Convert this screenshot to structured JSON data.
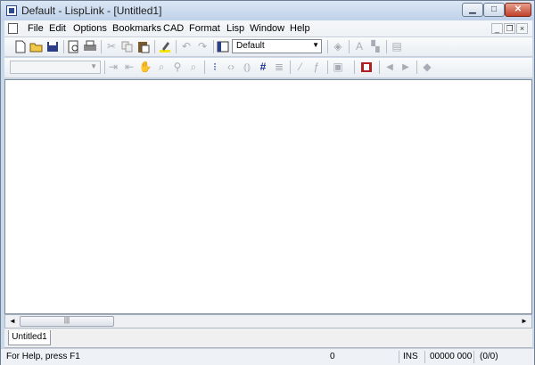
{
  "window": {
    "title": "Default - LispLink - [Untitled1]",
    "caption_buttons": {
      "minimize": "▁",
      "maximize": "□",
      "close": "✕"
    }
  },
  "menubar": {
    "items": [
      "File",
      "Edit",
      "Options",
      "Bookmarks",
      "CAD",
      "Format",
      "Lisp",
      "Window",
      "Help"
    ],
    "mdi_buttons": {
      "minimize": "_",
      "restore": "❐",
      "close": "×"
    }
  },
  "toolbar": {
    "style_combo_value": "Default",
    "font_combo_value": "",
    "icons": [
      "new-document-icon",
      "open-folder-icon",
      "save-icon",
      "print-preview-icon",
      "print-icon",
      "cut-icon",
      "copy-icon",
      "paste-icon",
      "highlight-icon",
      "undo-icon",
      "redo-icon",
      "style-icon",
      "layer-icon",
      "font-icon",
      "font-size-icon",
      "properties-icon",
      "indent-icon",
      "outdent-icon",
      "hand-icon",
      "magnify-icon",
      "pin-icon",
      "search-icon",
      "select-block-icon",
      "paren-icon",
      "brace-icon",
      "bookmark-hash-icon",
      "align-icon",
      "format-parens-icon",
      "function-icon",
      "clipboard-icon",
      "book-icon",
      "nav-back-icon",
      "nav-forward-icon",
      "eraser-icon"
    ]
  },
  "hscroll": {
    "thumb_grip": "|||",
    "left": "◄",
    "right": "►"
  },
  "tabs": [
    {
      "label": "Untitled1"
    }
  ],
  "statusbar": {
    "help": "For Help, press F1",
    "position": "0",
    "mode": "INS",
    "line_col": "00000 000",
    "selection": "(0/0)"
  }
}
